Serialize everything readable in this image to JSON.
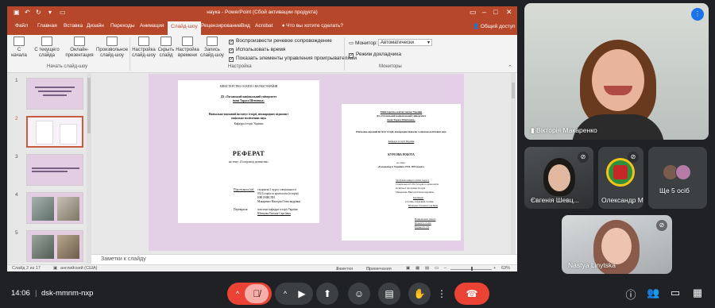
{
  "window": {
    "title": "наука - PowerPoint (Сбой активации продукта)"
  },
  "tabs": [
    "Файл",
    "Главная",
    "Вставка",
    "Дизайн",
    "Переходы",
    "Анимация",
    "Слайд-шоу",
    "Рецензирование",
    "Вид",
    "Acrobat"
  ],
  "tell_me": "Что вы хотите сделать?",
  "share": "Общий доступ",
  "ribbon": {
    "buttons": [
      "С начала",
      "С текущего слайда",
      "Онлайн-презентация",
      "Произвольное слайд-шоу",
      "Настройка слайд-шоу",
      "Скрыть слайд",
      "Настройка времени",
      "Запись слайд-шоу"
    ],
    "group_start": "Начать слайд-шоу",
    "group_setup": "Настройка",
    "group_monitors": "Мониторы",
    "checks": [
      "Воспроизвести речевое сопровождение",
      "Использовать время",
      "Показать элементы управления проигрывателями"
    ],
    "monitor_label": "Монитор:",
    "monitor_value": "Автоматически",
    "presenter_view": "Режим докладчика"
  },
  "thumbnails": [
    "1",
    "2",
    "3",
    "4",
    "5"
  ],
  "slide": {
    "left_page": {
      "ministry": "МІНІСТЕРСТВО ОСВІТИ І НАУКИ УКРАЇНИ",
      "university1": "ДЗ «Луганський національний університет",
      "university2": "імені Тараса Шевченка»",
      "institute1": "Навчально-науковий інститут історії, міжнародних відносин і",
      "institute2": "соціально-політичних наук",
      "department": "Кафедра історії України",
      "heading": "РЕФЕРАТ",
      "topic": "на тему: «Голодомор дитинства»",
      "prepared_label": "Підготувала (ла):",
      "prepared1": "студентка 1 курсу спеціальності",
      "prepared2": "032 Історія та археологія (історія)",
      "prepared3": "ННІ ІМВСПН",
      "prepared4": "Макаренко Вікторія Олександрівна",
      "checked_label": "Перевірила:",
      "checked1": "асистент кафедри історії України",
      "checked2": "Шевцова Євгенія Сергіївна"
    },
    "right_page": {
      "ministry": "Міністерство освіти і науки України",
      "university1": "ДЗ «Луганський національний університет",
      "university2": "імені Тараса Шевченка»",
      "institute": "Навчально-науковий інститут історії, міжнародних відносин і соціально-політичних наук",
      "department": "Кафедра історії України",
      "heading": "КУРСОВА РОБОТА",
      "topic1": "на тему:",
      "topic2": "«Голодомор в Україні в 1932-1933 роках»",
      "student1": "Здобувача вищої освіти I курсу",
      "student2": "Спеціальності 032 Історія та археологія",
      "student3": "Освітньої програми Історія",
      "student4": "Макаренко Вікторії Олександрівни",
      "sup1": "Керівник:",
      "sup2": "Ступінь, науковий ступінь",
      "sup3": "Шевцова Євгенія Сергіївна",
      "grade1": "Національна шкала",
      "grade2": "Кількість балів",
      "grade3": "Оцінка ECTS"
    }
  },
  "notes_placeholder": "Заметки к слайду",
  "status": {
    "slide": "Слайд 2 из 17",
    "language": "английский (США)",
    "notes": "Заметки",
    "comments": "Примечания",
    "zoom": "63%"
  },
  "participants": {
    "main": "Вікторія Макаренко",
    "p2": "Євгенія Шевц...",
    "p3": "Олександр М...",
    "more": "Ще 5 осіб",
    "p5": "Nastya Linytska"
  },
  "meeting": {
    "time": "14:06",
    "code": "dsk-mmnm-nxp",
    "participants_count": "10"
  }
}
